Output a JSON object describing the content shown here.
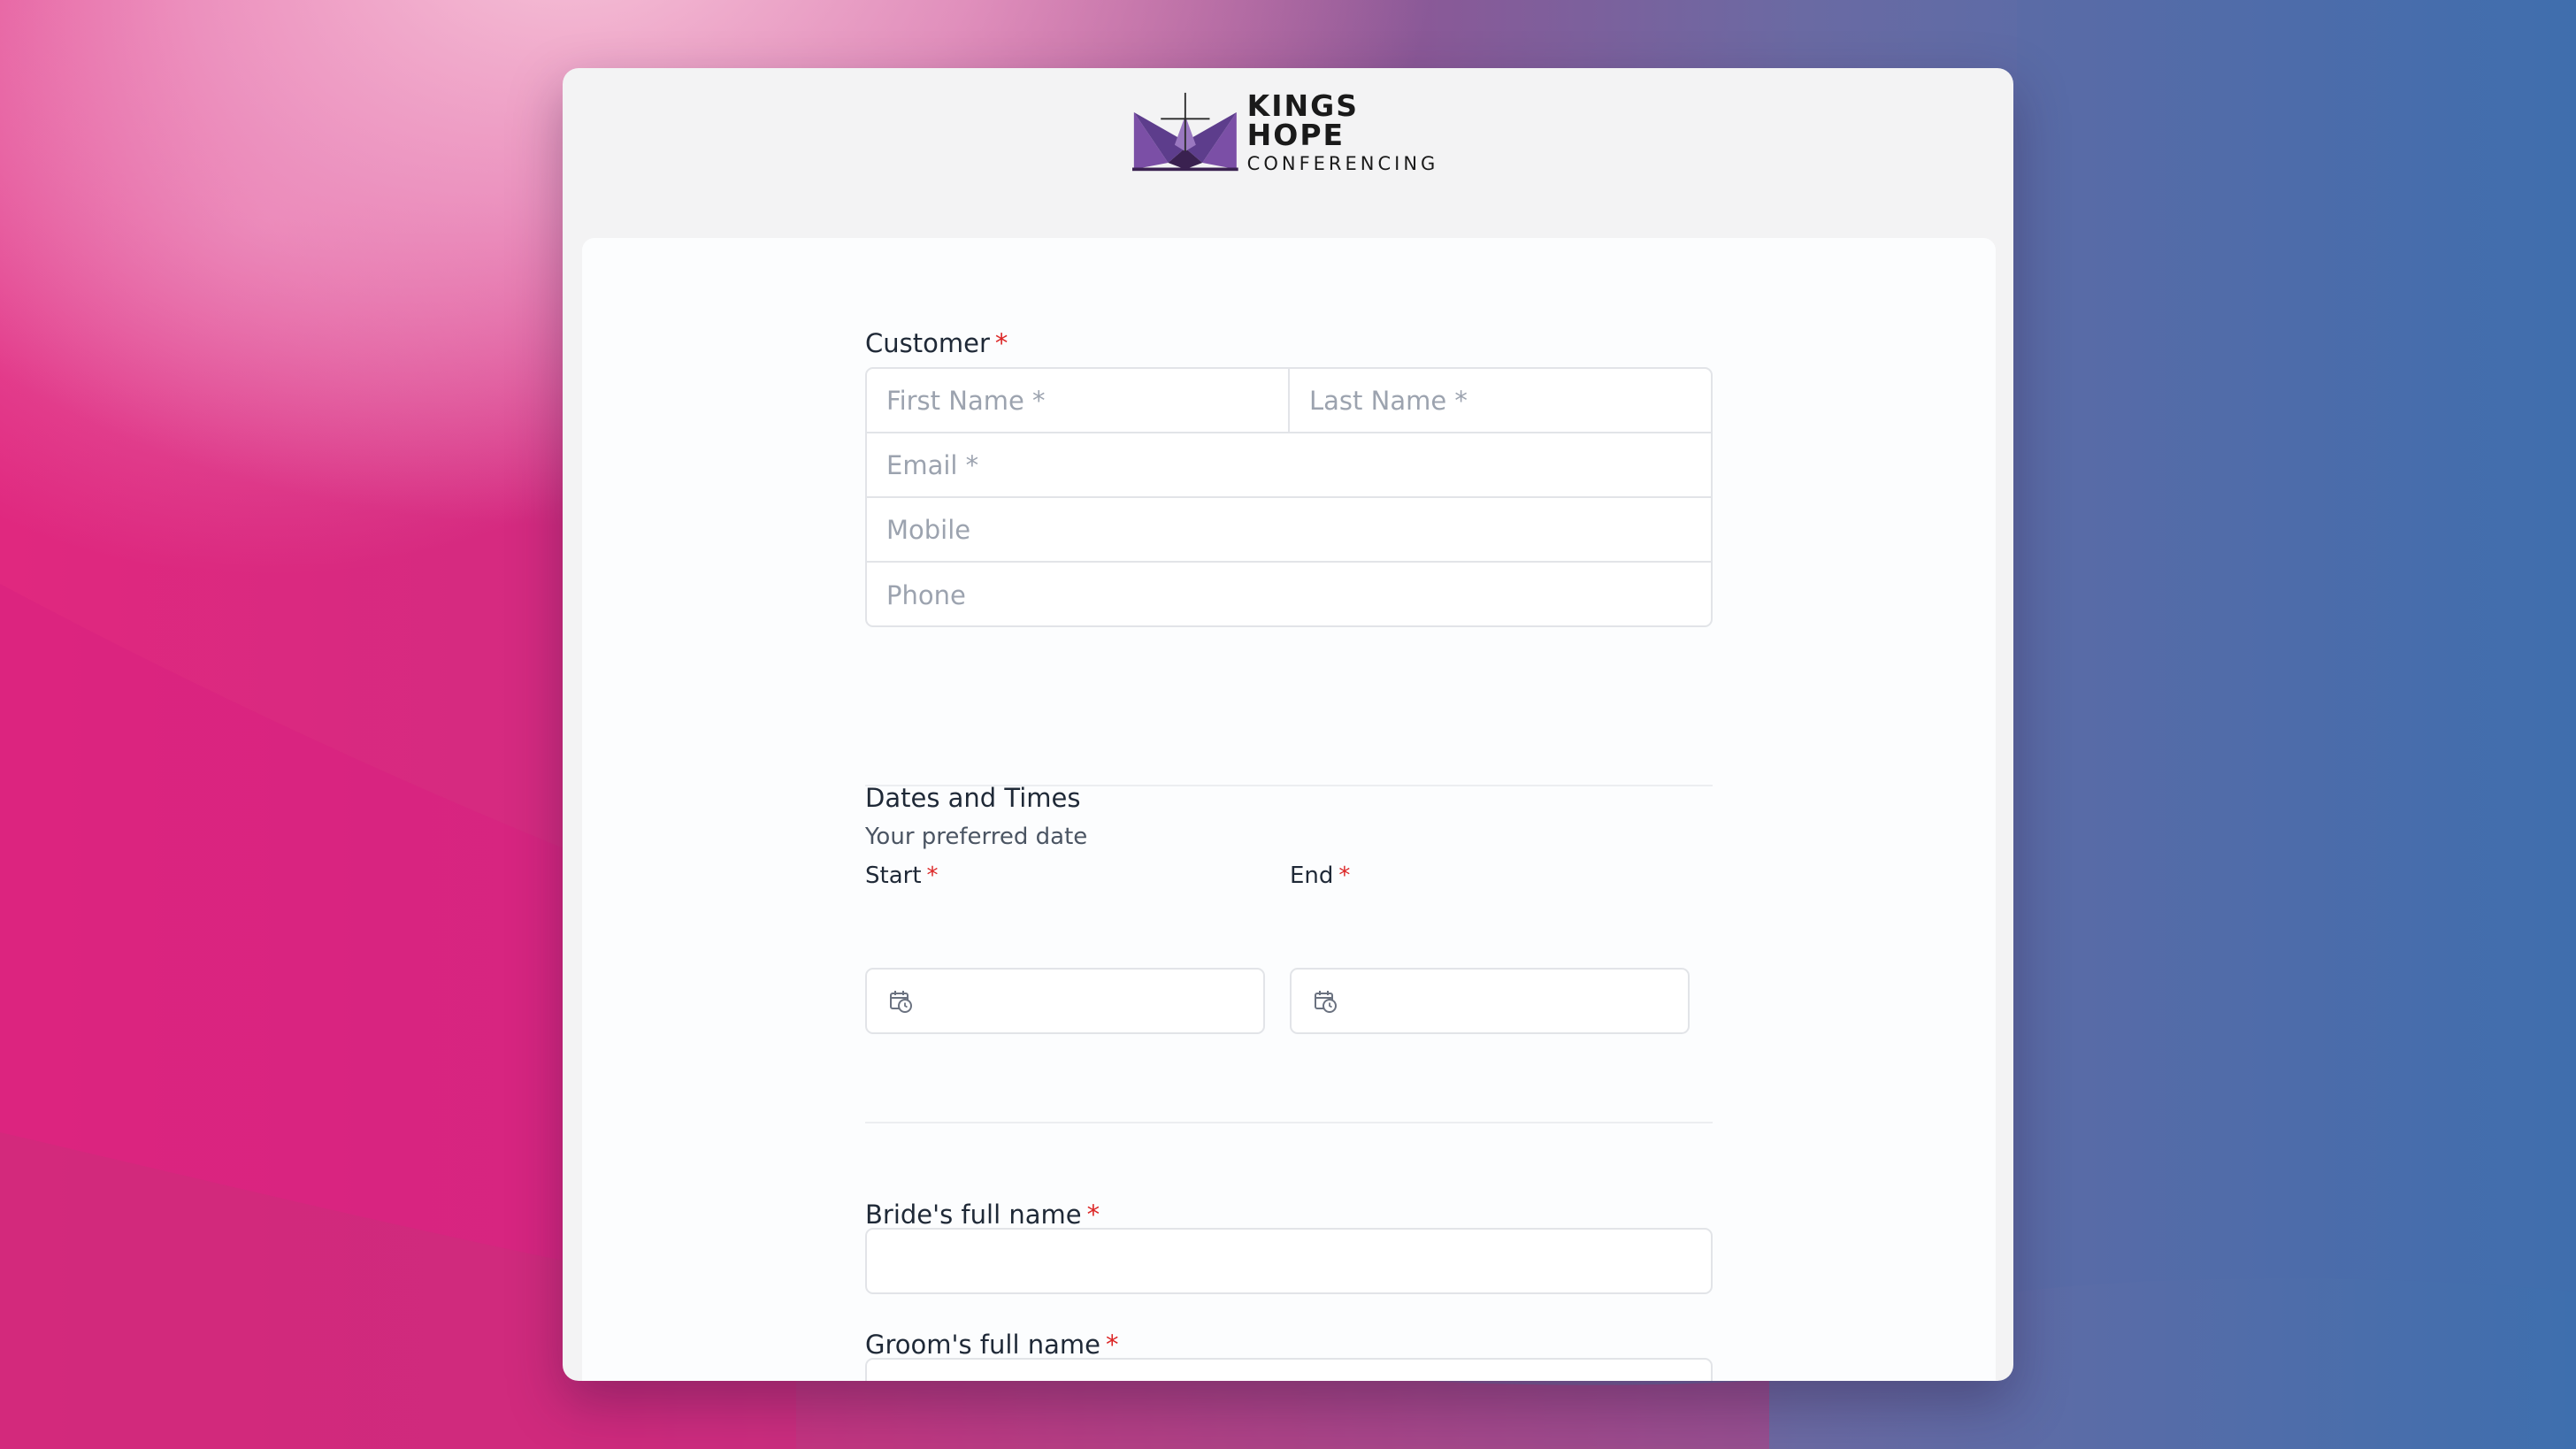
{
  "brand": {
    "name": "KINGS HOPE",
    "tagline": "CONFERENCING"
  },
  "customer": {
    "label": "Customer",
    "required_mark": "*",
    "first_name_placeholder": "First Name *",
    "last_name_placeholder": "Last Name *",
    "email_placeholder": "Email *",
    "mobile_placeholder": "Mobile",
    "phone_placeholder": "Phone"
  },
  "dates": {
    "heading": "Dates and Times",
    "hint": "Your preferred date",
    "start_label": "Start",
    "end_label": "End",
    "required_mark": "*",
    "start_value": "",
    "end_value": ""
  },
  "bride": {
    "label": "Bride's full name",
    "required_mark": "*",
    "value": ""
  },
  "groom": {
    "label": "Groom's full name",
    "required_mark": "*",
    "value": ""
  },
  "colors": {
    "required": "#dc2626",
    "logo_purple": "#7b4fa6",
    "logo_dark": "#3a2150"
  }
}
